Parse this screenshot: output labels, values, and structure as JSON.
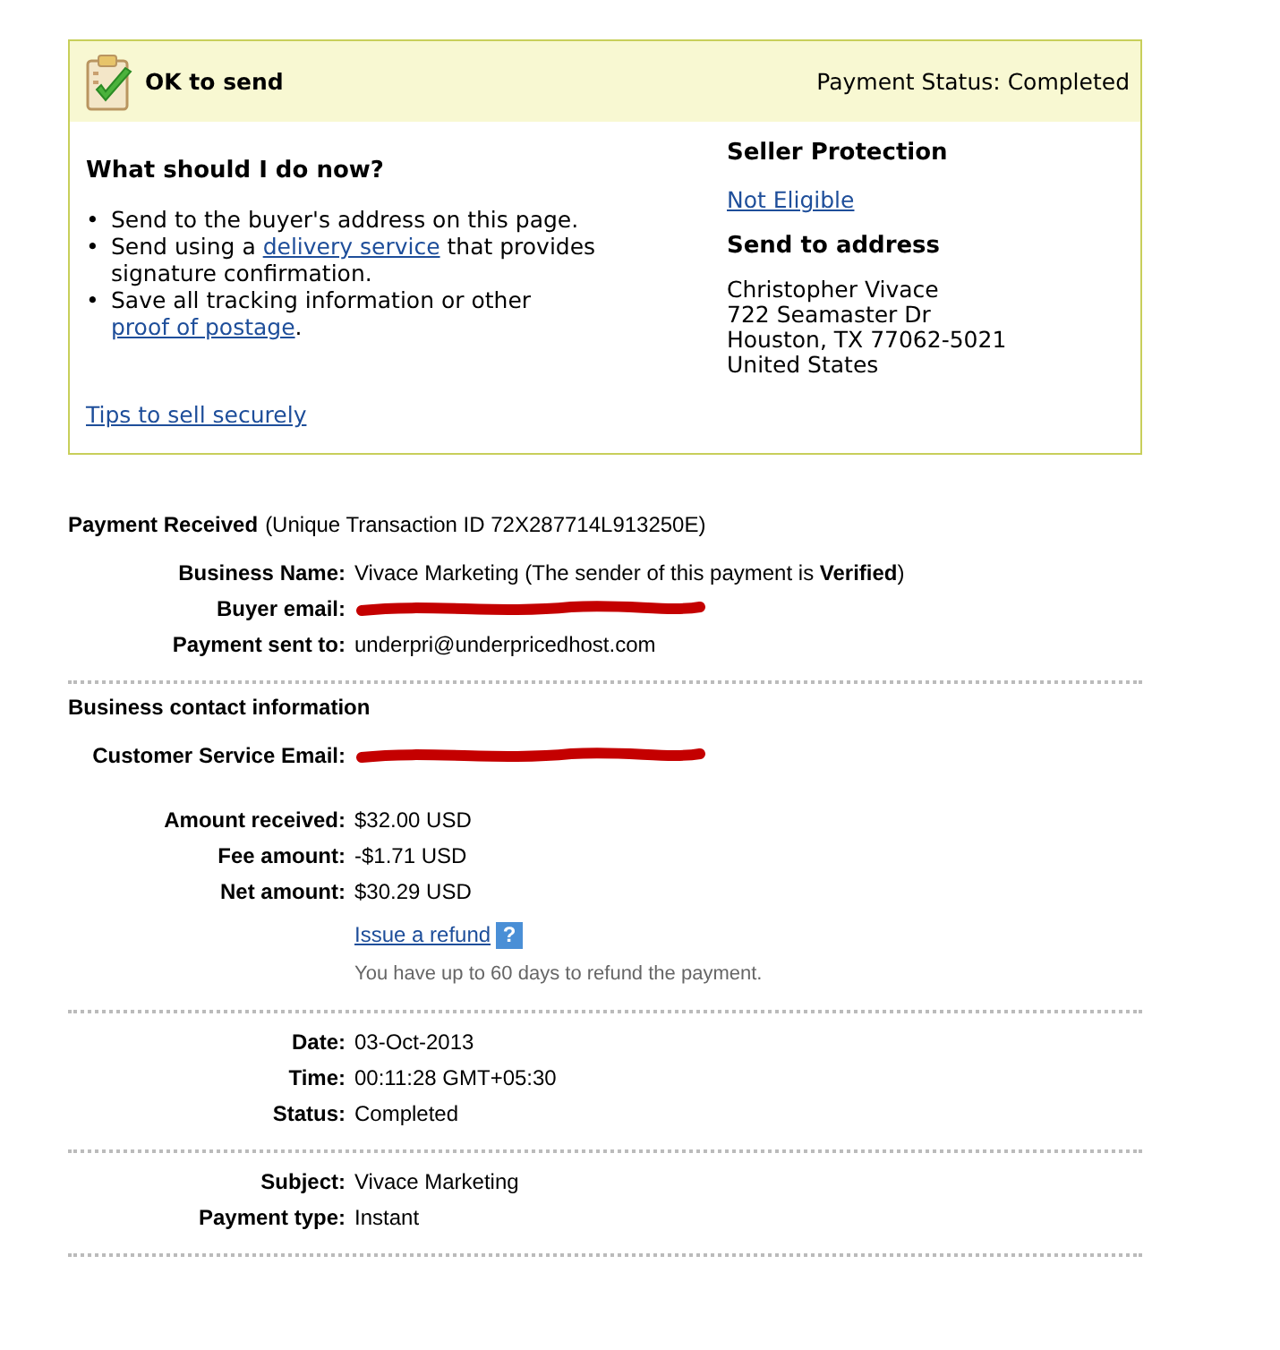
{
  "status_box": {
    "title": "OK to send",
    "payment_status": "Payment Status: Completed",
    "instructions_heading": "What should I do now?",
    "instructions": [
      {
        "bullet": "•",
        "parts": [
          {
            "text": "Send to the buyer's address on this page.",
            "link": false
          }
        ]
      },
      {
        "bullet": "•",
        "parts": [
          {
            "text": "Send using a ",
            "link": false
          },
          {
            "text": "delivery service",
            "link": true
          },
          {
            "text": " that provides signature confirmation.",
            "link": false
          }
        ]
      },
      {
        "bullet": "•",
        "parts": [
          {
            "text": "Save all tracking information or other ",
            "link": false
          },
          {
            "text": "proof of postage",
            "link": true
          },
          {
            "text": ".",
            "link": false
          }
        ]
      }
    ],
    "tips_link": "Tips to sell securely",
    "seller_protection_heading": "Seller Protection",
    "seller_protection_link": "Not Eligible",
    "address_heading": "Send to address",
    "address_lines": [
      "Christopher Vivace",
      "722 Seamaster Dr",
      "Houston, TX 77062-5021",
      "United States"
    ]
  },
  "sections": [
    {
      "heading": "Payment Received",
      "heading_note": "(Unique Transaction ID 72X287714L913250E)",
      "divider": true,
      "rows": [
        {
          "kind": "text",
          "label": "Business Name:",
          "value": "Vivace Marketing (The sender of this payment is **Verified**)"
        },
        {
          "kind": "redacted",
          "label": "Buyer email:"
        },
        {
          "kind": "text",
          "label": "Payment sent to:",
          "value": "underpri@underpricedhost.com"
        }
      ]
    },
    {
      "heading": "Business contact information",
      "divider": false,
      "rows": [
        {
          "kind": "redacted",
          "label": "Customer Service Email:"
        }
      ]
    },
    {
      "divider": true,
      "rows": [
        {
          "kind": "text",
          "label": "Amount received:",
          "value": "$32.00 USD"
        },
        {
          "kind": "text",
          "label": "Fee amount:",
          "value": "-$1.71 USD"
        },
        {
          "kind": "text",
          "label": "Net amount:",
          "value": "$30.29 USD"
        },
        {
          "kind": "refund",
          "link": "Issue a refund",
          "help": "?"
        },
        {
          "kind": "note",
          "value": "You have up to 60 days to refund the payment."
        }
      ]
    },
    {
      "divider": true,
      "rows": [
        {
          "kind": "text",
          "label": "Date:",
          "value": "03-Oct-2013"
        },
        {
          "kind": "text",
          "label": "Time:",
          "value": "00:11:28 GMT+05:30"
        },
        {
          "kind": "text",
          "label": "Status:",
          "value": "Completed"
        }
      ]
    },
    {
      "divider": true,
      "rows": [
        {
          "kind": "text",
          "label": "Subject:",
          "value": "Vivace Marketing"
        },
        {
          "kind": "text",
          "label": "Payment type:",
          "value": "Instant"
        }
      ]
    }
  ]
}
